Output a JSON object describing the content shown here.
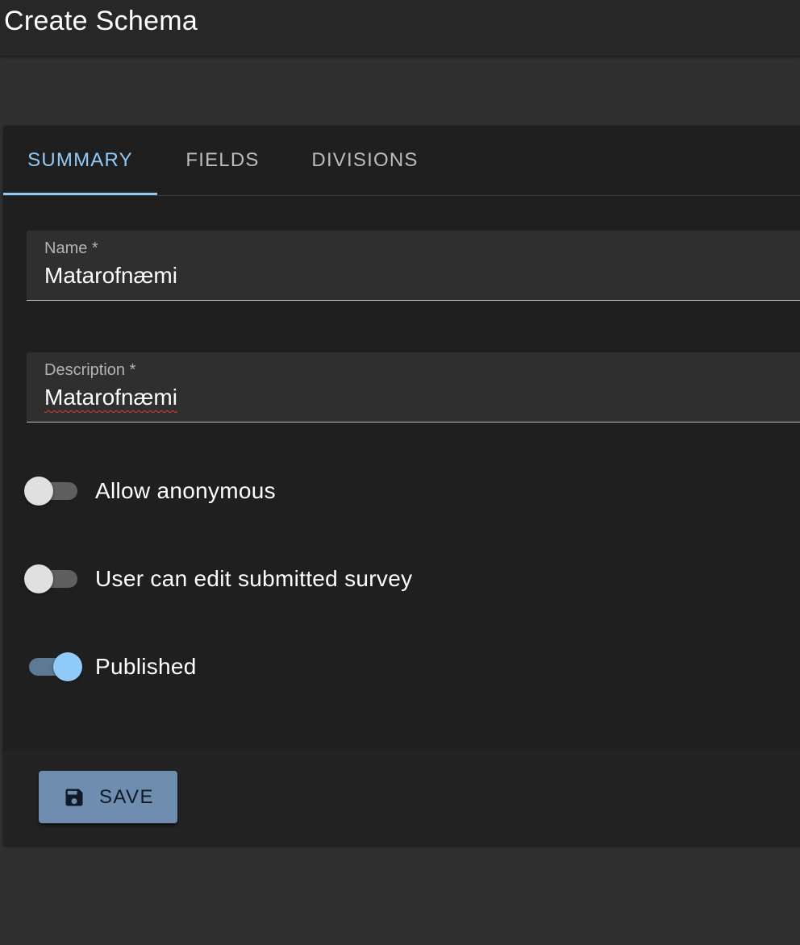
{
  "appbar": {
    "title": "Create Schema"
  },
  "tabs": [
    {
      "label": "SUMMARY",
      "active": true
    },
    {
      "label": "FIELDS",
      "active": false
    },
    {
      "label": "DIVISIONS",
      "active": false
    }
  ],
  "form": {
    "name": {
      "label": "Name *",
      "value": "Matarofnæmi"
    },
    "description": {
      "label": "Description *",
      "value": "Matarofnæmi"
    },
    "switches": [
      {
        "label": "Allow anonymous",
        "checked": false
      },
      {
        "label": "User can edit submitted survey",
        "checked": false
      },
      {
        "label": "Published",
        "checked": true
      }
    ]
  },
  "actions": {
    "save_label": "SAVE",
    "save_icon": "floppy-disk-icon"
  },
  "colors": {
    "accent": "#90caf9",
    "button": "#6e8daf",
    "surface": "#1f1f1f",
    "background": "#303030"
  }
}
